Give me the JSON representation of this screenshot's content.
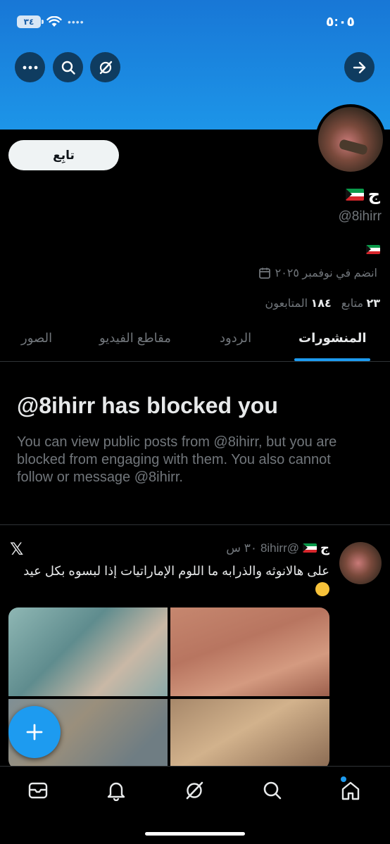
{
  "status_bar": {
    "time": "٥:٠٥",
    "battery": "٣٤"
  },
  "profile": {
    "name": "ج",
    "handle": "@8ihirr",
    "joined": "انضم في نوفمبر ٢٠٢٥",
    "following_count": "٢٣",
    "following_label": "متابع",
    "followers_count": "١٨٤",
    "followers_label": "المتابعون",
    "follow_button": "تابِع"
  },
  "tabs": [
    {
      "label": "المنشورات",
      "active": true
    },
    {
      "label": "الردود",
      "active": false
    },
    {
      "label": "مقاطع الفيديو",
      "active": false
    },
    {
      "label": "الصور",
      "active": false
    }
  ],
  "blocked": {
    "title": "@8ihirr has blocked you",
    "description": "You can view public posts from @8ihirr, but you are blocked from engaging with them. You also cannot follow or message @8ihirr."
  },
  "post": {
    "name": "ج",
    "handle": "@8ihirr",
    "time": "٣٠ س",
    "text": "على هالانوثه والذرابه ما اللوم الإماراتيات إذا لبسوه بكل عيد",
    "x_logo": "𝕏"
  },
  "icons": {
    "top_left": [
      "more-icon",
      "search-icon",
      "grok-icon"
    ],
    "top_right": "forward-arrow-icon",
    "nav": [
      "messages-icon",
      "notifications-icon",
      "grok-icon",
      "search-icon",
      "home-icon"
    ]
  },
  "colors": {
    "accent": "#1d9bf0",
    "banner": "#1d8fe3",
    "muted": "#71767b"
  }
}
